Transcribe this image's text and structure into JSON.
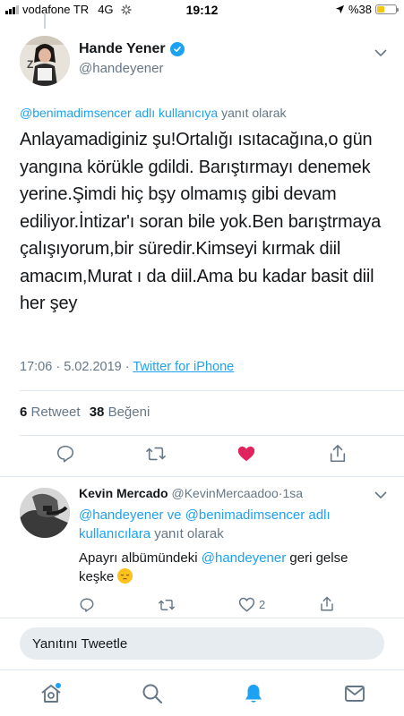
{
  "status_bar": {
    "carrier": "vodafone TR",
    "network": "4G",
    "time": "19:12",
    "battery_text": "%38",
    "battery_level": 0.38
  },
  "main_tweet": {
    "author_name": "Hande Yener",
    "author_handle": "@handeyener",
    "verified": true,
    "reply_to_link": "@benimadimsencer adlı kullanıcıya",
    "reply_to_suffix": "yanıt olarak",
    "text": "Anlayamadiginiz şu!Ortalığı ısıtacağına,o gün yangına körükle gdildi. Barıştırmayı denemek yerine.Şimdi hiç bşy olmamış gibi devam ediliyor.İntizar'ı soran bile yok.Ben barıştrmaya çalışıyorum,bir süredir.Kimseyi kırmak diil amacım,Murat ı da diil.Ama bu kadar basit diil her şey",
    "time": "17:06",
    "date": "5.02.2019",
    "separator": "·",
    "source": "Twitter for iPhone",
    "retweet_count": "6",
    "retweet_label": "Retweet",
    "like_count": "38",
    "like_label": "Beğeni",
    "liked": true
  },
  "reply_tweet": {
    "author_name": "Kevin Mercado",
    "author_handle": "@KevinMercaadoo",
    "separator": "·",
    "age": "1sa",
    "reply_to_link": "@handeyener ve @benimadimsencer adlı kullanıcılara",
    "reply_to_suffix": "yanıt olarak",
    "text_before": "Apayrı albümündeki ",
    "text_mention": "@handeyener",
    "text_after": " geri gelse keşke",
    "like_count": "2"
  },
  "compose": {
    "placeholder": "Yanıtını Tweetle"
  },
  "tab_bar": {
    "items": [
      "home-icon",
      "search-icon",
      "notifications-icon",
      "messages-icon"
    ],
    "active": "notifications-icon"
  },
  "colors": {
    "accent": "#1da1f2",
    "like": "#e0245e",
    "secondary_text": "#657786",
    "battery": "#f5c518"
  }
}
